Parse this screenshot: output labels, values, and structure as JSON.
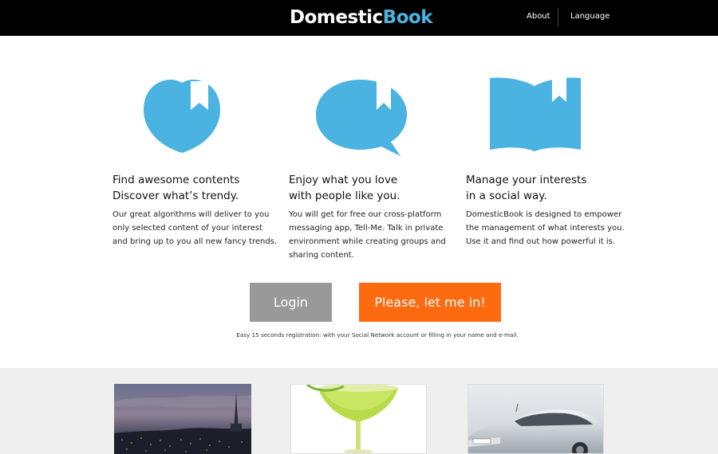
{
  "header": {
    "logo_part1": "Domestic",
    "logo_part2": "Book",
    "nav": {
      "about": "About",
      "language": "Language"
    }
  },
  "features": [
    {
      "icon": "heart-bookmark-icon",
      "title_line1": "Find awesome contents",
      "title_line2": "Discover what’s trendy.",
      "body": "Our great algorithms will deliver to you only selected content of your interest and bring up to you all new fancy trends."
    },
    {
      "icon": "speech-bubble-bookmark-icon",
      "title_line1": "Enjoy what you love",
      "title_line2": "with people like you.",
      "body": "You will get for free our cross-platform messaging app, Tell-Me. Talk in private environment while creating groups and sharing content."
    },
    {
      "icon": "open-book-bookmark-icon",
      "title_line1": "Manage your interests",
      "title_line2": "in a social way.",
      "body": "DomesticBook is designed to empower the management of what interests you. Use it and find out how powerful it is."
    }
  ],
  "actions": {
    "login_label": "Login",
    "signup_label": "Please, let me in!",
    "registration_note": "Easy 15 seconds registration: with your Social Network account or filling in your name and e-mail."
  },
  "gallery": [
    {
      "name": "city-skyline-photo"
    },
    {
      "name": "cocktail-glass-photo"
    },
    {
      "name": "silver-car-photo"
    }
  ],
  "colors": {
    "accent_blue": "#4ab3e1",
    "orange": "#fe6a10",
    "login_gray": "#999999",
    "header_black": "#000000"
  }
}
